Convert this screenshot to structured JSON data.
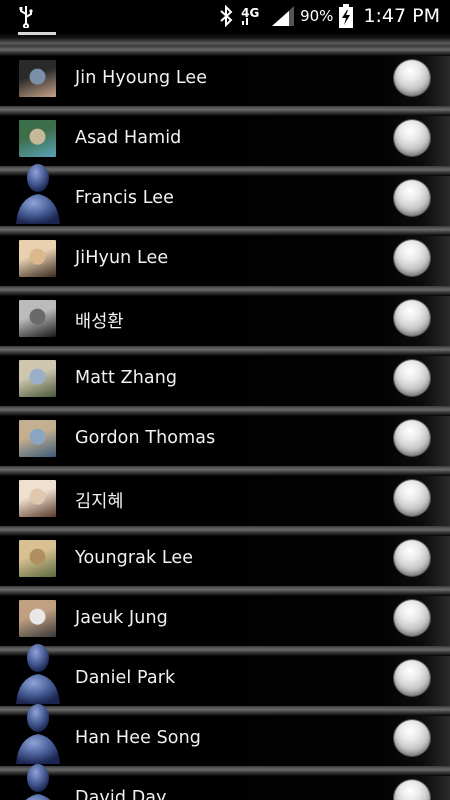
{
  "status_bar": {
    "network": "4G",
    "battery_percent": "90%",
    "time": "1:47 PM",
    "icons": [
      "usb-icon",
      "bluetooth-icon",
      "lte-icon",
      "signal-icon",
      "battery-charging-icon"
    ]
  },
  "contacts": [
    {
      "name": "Jin Hyoung Lee",
      "avatar": "photo",
      "colors": [
        "#7a8fa8",
        "#c9a48a",
        "#2a2a2a"
      ]
    },
    {
      "name": "Asad Hamid",
      "avatar": "photo",
      "colors": [
        "#c8b89a",
        "#5aa3b8",
        "#3c6e4a"
      ]
    },
    {
      "name": "Francis Lee",
      "avatar": "silhouette",
      "colors": [
        "#4a5f99",
        "#1b2550",
        "#8fa3d6"
      ]
    },
    {
      "name": "JiHyun Lee",
      "avatar": "photo",
      "colors": [
        "#d9b98c",
        "#3a2a20",
        "#e8d0b0"
      ]
    },
    {
      "name": "배성환",
      "avatar": "photo",
      "colors": [
        "#6a6a6a",
        "#1a1a1a",
        "#bbbbbb"
      ]
    },
    {
      "name": "Matt Zhang",
      "avatar": "photo",
      "colors": [
        "#9ab0c8",
        "#4a5a3a",
        "#cfc6b0"
      ]
    },
    {
      "name": "Gordon Thomas",
      "avatar": "photo",
      "colors": [
        "#8aa6c0",
        "#3c5a78",
        "#c4b090"
      ]
    },
    {
      "name": "김지혜",
      "avatar": "photo",
      "colors": [
        "#e0c8b0",
        "#5a3a2a",
        "#f0e0d0"
      ]
    },
    {
      "name": "Youngrak Lee",
      "avatar": "photo",
      "colors": [
        "#b09060",
        "#5a6a40",
        "#d8c090"
      ]
    },
    {
      "name": "Jaeuk Jung",
      "avatar": "photo",
      "colors": [
        "#e8e8e8",
        "#3a3a3a",
        "#c0a080"
      ]
    },
    {
      "name": "Daniel Park",
      "avatar": "silhouette",
      "colors": [
        "#4a5f99",
        "#1b2550",
        "#8fa3d6"
      ]
    },
    {
      "name": "Han Hee Song",
      "avatar": "silhouette",
      "colors": [
        "#4a5f99",
        "#1b2550",
        "#8fa3d6"
      ]
    },
    {
      "name": "David Day",
      "avatar": "silhouette",
      "colors": [
        "#4a5f99",
        "#1b2550",
        "#8fa3d6"
      ]
    }
  ]
}
